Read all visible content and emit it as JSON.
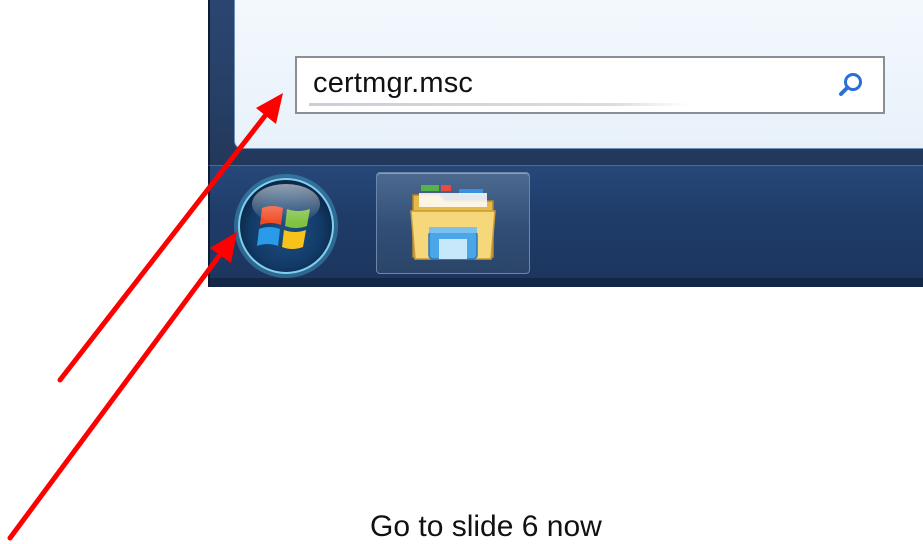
{
  "search": {
    "value": "certmgr.msc",
    "icon": "search-icon"
  },
  "taskbar": {
    "start_icon": "windows-start-orb-icon",
    "pinned": [
      {
        "icon": "windows-explorer-icon"
      }
    ]
  },
  "annotations": {
    "arrow_color": "#ff0000",
    "caption": "Go to slide 6 now"
  }
}
